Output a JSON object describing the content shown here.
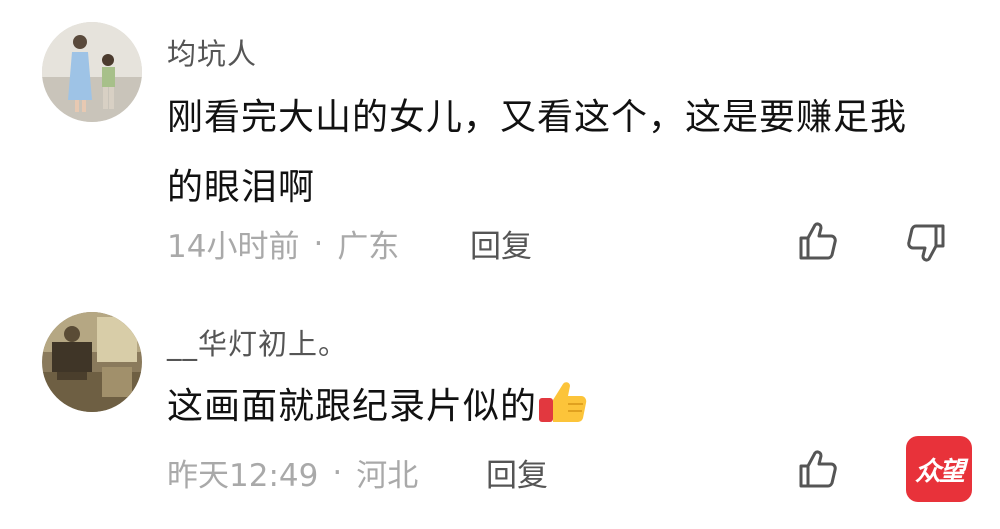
{
  "comments": [
    {
      "username": "均坑人",
      "text": "刚看完大山的女儿，又看这个，这是要赚足我的眼泪啊",
      "time": "14小时前",
      "location": "广东",
      "separator": "·",
      "reply_label": "回复",
      "avatar_icon": "avatar-child-photo-icon",
      "actions": [
        "thumbs-up-icon",
        "thumbs-down-icon"
      ]
    },
    {
      "username": "__华灯初上。",
      "text": "这画面就跟纪录片似的",
      "emoji": "thumbs-up-emoji",
      "time": "昨天12:49",
      "location": "河北",
      "separator": "·",
      "reply_label": "回复",
      "avatar_icon": "avatar-vintage-photo-icon",
      "actions": [
        "thumbs-up-icon"
      ]
    }
  ],
  "watermark": {
    "text": "众望",
    "color": "#e8323a"
  },
  "colors": {
    "username": "#555555",
    "text": "#111111",
    "meta": "#a9a9a9",
    "reply": "#555555"
  }
}
